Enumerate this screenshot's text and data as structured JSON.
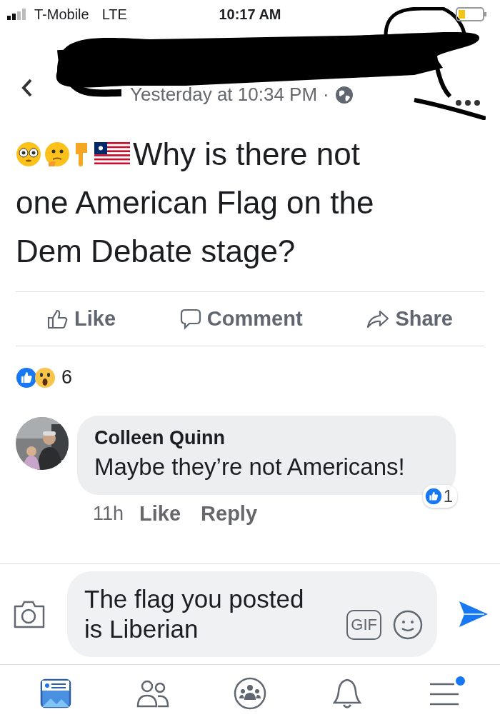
{
  "status_bar": {
    "carrier": "T-Mobile",
    "network": "LTE",
    "time": "10:17 AM"
  },
  "post": {
    "timestamp": "Yesterday at 10:34 PM",
    "separator": "·",
    "text_lines": [
      "Why is there not",
      "one American Flag on the",
      "Dem Debate stage?"
    ],
    "actions": [
      {
        "kind": "like",
        "label": "Like"
      },
      {
        "kind": "comment",
        "label": "Comment"
      },
      {
        "kind": "share",
        "label": "Share"
      }
    ],
    "reaction_count": "6"
  },
  "comments": [
    {
      "author": "Colleen Quinn",
      "text": "Maybe they’re not Americans!",
      "age": "11h",
      "actions": [
        "Like",
        "Reply"
      ],
      "like_count": "1"
    }
  ],
  "composer": {
    "value": "The flag you posted is Liberian",
    "gif_label": "GIF"
  },
  "tabs": [
    {
      "kind": "feed",
      "selected": true,
      "notification": false
    },
    {
      "kind": "friends",
      "selected": false,
      "notification": false
    },
    {
      "kind": "groups",
      "selected": false,
      "notification": false
    },
    {
      "kind": "notifications",
      "selected": false,
      "notification": false
    },
    {
      "kind": "menu",
      "selected": false,
      "notification": true
    }
  ]
}
